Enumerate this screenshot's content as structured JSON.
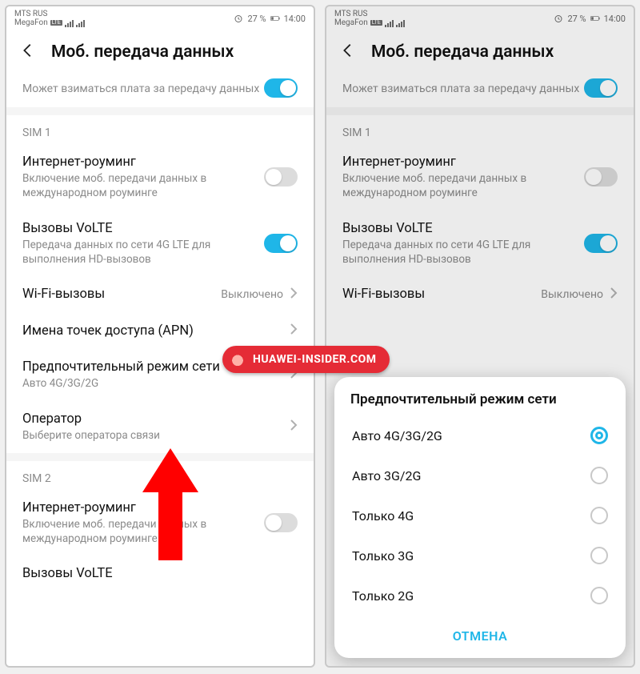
{
  "status": {
    "carrier1": "MTS RUS",
    "carrier2": "MegaFon",
    "carrier2_badge": "LTE",
    "battery_pct": "27 %",
    "time": "14:00"
  },
  "header": {
    "title": "Моб. передача данных"
  },
  "intro": {
    "desc": "Может взиматься плата за передачу данных"
  },
  "sim1": {
    "label": "SIM 1",
    "roaming": {
      "title": "Интернет-роуминг",
      "desc": "Включение моб. передачи данных в международном роуминге"
    },
    "volte": {
      "title": "Вызовы VoLTE",
      "desc": "Передача данных по сети 4G LTE для выполнения HD-вызовов"
    },
    "wificall": {
      "title": "Wi-Fi-вызовы",
      "value": "Выключено"
    },
    "apn": {
      "title": "Имена точек доступа (APN)"
    },
    "netmode": {
      "title": "Предпочтительный режим сети",
      "value": "Авто 4G/3G/2G"
    },
    "operator": {
      "title": "Оператор",
      "desc": "Выберите оператора связи"
    }
  },
  "sim2": {
    "label": "SIM 2",
    "roaming": {
      "title": "Интернет-роуминг",
      "desc": "Включение моб. передачи данных в международном роуминге"
    },
    "volte": {
      "title": "Вызовы VoLTE"
    }
  },
  "dialog": {
    "title": "Предпочтительный режим сети",
    "options": {
      "0": "Авто 4G/3G/2G",
      "1": "Авто 3G/2G",
      "2": "Только 4G",
      "3": "Только 3G",
      "4": "Только 2G"
    },
    "cancel": "ОТМЕНА"
  },
  "right_wificall": {
    "title": "Wi-Fi-вызовы",
    "value": "Выключено"
  },
  "watermark": "HUAWEI-INSIDER.COM"
}
